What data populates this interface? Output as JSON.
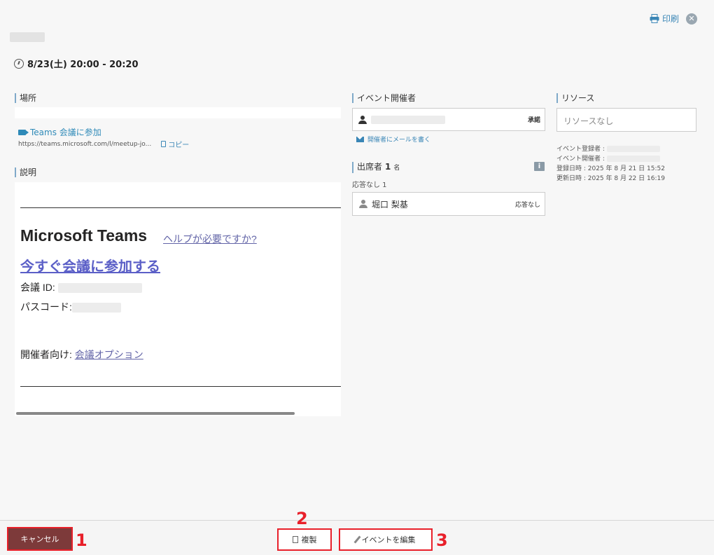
{
  "header": {
    "print_label": "印刷",
    "close_glyph": "✕",
    "datetime": "8/23(土) 20:00 - 20:20"
  },
  "location": {
    "label": "場所",
    "teams_link": "Teams 会議に参加",
    "url": "https://teams.microsoft.com/l/meetup-jo...",
    "copy_label": "コピー"
  },
  "description": {
    "label": "説明",
    "ms_title": "Microsoft Teams",
    "help_link": "ヘルプが必要ですか?",
    "join_link": "今すぐ会議に参加する",
    "meeting_id_label": "会議 ID: ",
    "passcode_label": "パスコード:",
    "organizer_prefix": "開催者向け: ",
    "options_link": "会議オプション"
  },
  "organizer": {
    "label": "イベント開催者",
    "status": "承諾",
    "mail_link": "開催者にメールを書く"
  },
  "attendees": {
    "label": "出席者",
    "count": "1",
    "unit": "名",
    "info_glyph": "i",
    "no_response_label": "応答なし 1",
    "items": [
      {
        "name": "堀口 梨基",
        "status": "応答なし"
      }
    ]
  },
  "resources": {
    "label": "リソース",
    "value": "リソースなし"
  },
  "meta": {
    "registrant_label": "イベント登録者 : ",
    "organizer_label": "イベント開催者 : ",
    "registered": "登録日時 : 2025 年 8 月 21 日 15:52",
    "updated": "更新日時 : 2025 年 8 月 22 日 16:19"
  },
  "footer": {
    "cancel_label": "キャンセル",
    "duplicate_label": "複製",
    "edit_label": "イベントを編集"
  },
  "annotations": {
    "step1": "1",
    "step2": "2",
    "step3": "3"
  },
  "colors": {
    "annotation_red": "#e8202a",
    "cancel_bg": "#7d3a3a",
    "link_blue": "#3a86b6",
    "teams_purple": "#5b5fc7"
  }
}
